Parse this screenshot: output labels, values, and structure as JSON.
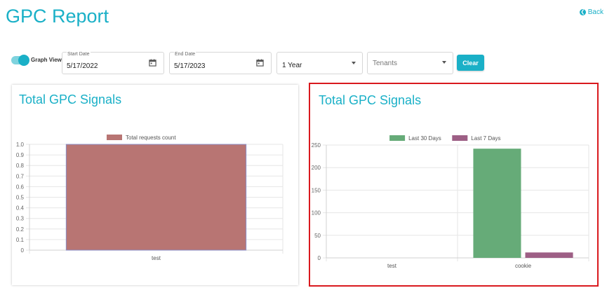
{
  "header": {
    "title": "GPC Report",
    "back_label": "Back"
  },
  "filters": {
    "graph_view_label": "Graph View",
    "graph_view_on": true,
    "start_date_label": "Start Date",
    "start_date_value": "5/17/2022",
    "end_date_label": "End Date",
    "end_date_value": "5/17/2023",
    "range_value": "1 Year",
    "tenants_placeholder": "Tenants",
    "clear_label": "Clear"
  },
  "colors": {
    "accent": "#1ab0c7",
    "bar_requests": "#b87573",
    "bar_30": "#66ab78",
    "bar_7": "#9d5f85",
    "highlight_border": "#d9191e"
  },
  "chart_data": [
    {
      "type": "bar",
      "title": "Total GPC Signals",
      "categories": [
        "test"
      ],
      "series": [
        {
          "name": "Total requests count",
          "values": [
            1.0
          ]
        }
      ],
      "ylim": [
        0,
        1.0
      ],
      "yticks": [
        "1.0",
        "0.9",
        "0.8",
        "0.7",
        "0.6",
        "0.5",
        "0.4",
        "0.3",
        "0.2",
        "0.1",
        "0"
      ],
      "legend": "top",
      "grid": true
    },
    {
      "type": "bar",
      "title": "Total GPC Signals",
      "categories": [
        "test",
        "cookie"
      ],
      "series": [
        {
          "name": "Last 30 Days",
          "values": [
            0,
            242
          ]
        },
        {
          "name": "Last 7 Days",
          "values": [
            0,
            12
          ]
        }
      ],
      "ylim": [
        0,
        250
      ],
      "yticks": [
        "250",
        "200",
        "150",
        "100",
        "50",
        "0"
      ],
      "legend": "top",
      "grid": true
    }
  ]
}
